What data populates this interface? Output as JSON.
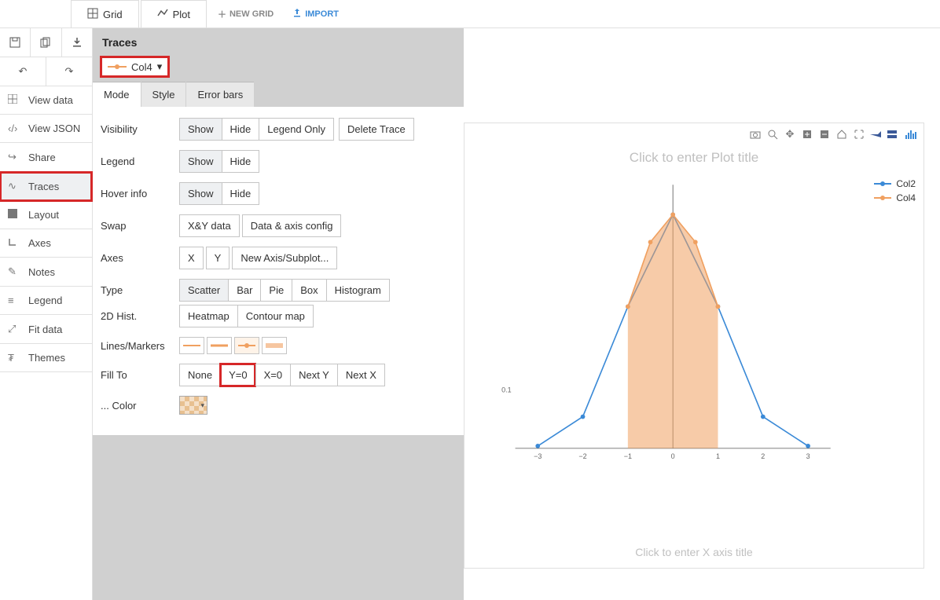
{
  "top": {
    "tabs": [
      {
        "label": "Grid"
      },
      {
        "label": "Plot"
      }
    ],
    "new_grid": "NEW GRID",
    "import": "IMPORT"
  },
  "sidebar": {
    "items": [
      {
        "label": "View data"
      },
      {
        "label": "View JSON"
      },
      {
        "label": "Share"
      },
      {
        "label": "Traces"
      },
      {
        "label": "Layout"
      },
      {
        "label": "Axes"
      },
      {
        "label": "Notes"
      },
      {
        "label": "Legend"
      },
      {
        "label": "Fit data"
      },
      {
        "label": "Themes"
      }
    ]
  },
  "panel": {
    "title": "Traces",
    "selected_trace": "Col4",
    "subtabs": [
      "Mode",
      "Style",
      "Error bars"
    ],
    "rows": {
      "visibility": {
        "label": "Visibility",
        "show": "Show",
        "hide": "Hide",
        "legend_only": "Legend Only",
        "delete": "Delete Trace"
      },
      "legend": {
        "label": "Legend",
        "show": "Show",
        "hide": "Hide"
      },
      "hover": {
        "label": "Hover info",
        "show": "Show",
        "hide": "Hide"
      },
      "swap": {
        "label": "Swap",
        "xy": "X&Y data",
        "config": "Data & axis config"
      },
      "axes": {
        "label": "Axes",
        "x": "X",
        "y": "Y",
        "new": "New Axis/Subplot..."
      },
      "type": {
        "label": "Type",
        "label2": "2D Hist.",
        "opts": [
          "Scatter",
          "Bar",
          "Pie",
          "Box",
          "Histogram"
        ],
        "opts2": [
          "Heatmap",
          "Contour map"
        ]
      },
      "lines": {
        "label": "Lines/Markers"
      },
      "fill": {
        "label": "Fill To",
        "opts": [
          "None",
          "Y=0",
          "X=0",
          "Next Y",
          "Next X"
        ]
      },
      "color": {
        "label": "... Color"
      }
    }
  },
  "plot": {
    "title_placeholder": "Click to enter Plot title",
    "x_title_placeholder": "Click to enter X axis title",
    "legend": [
      "Col2",
      "Col4"
    ],
    "y_tick_visible": "0.1",
    "x_ticks": [
      "−3",
      "−2",
      "−1",
      "0",
      "1",
      "2",
      "3"
    ]
  },
  "chart_data": {
    "type": "line",
    "xlabel": "",
    "ylabel": "",
    "xlim": [
      -3.5,
      3.5
    ],
    "ylim": [
      0,
      0.45
    ],
    "series": [
      {
        "name": "Col2",
        "x": [
          -3,
          -2,
          -1,
          0,
          1,
          2,
          3
        ],
        "y": [
          0.004,
          0.054,
          0.242,
          0.399,
          0.242,
          0.054,
          0.004
        ],
        "color": "#3b8ad7",
        "fill": false
      },
      {
        "name": "Col4",
        "x": [
          -1,
          -0.5,
          0,
          0.5,
          1
        ],
        "y": [
          0.242,
          0.352,
          0.399,
          0.352,
          0.242
        ],
        "color": "#f0a060",
        "fill": "tozeroy"
      }
    ]
  }
}
